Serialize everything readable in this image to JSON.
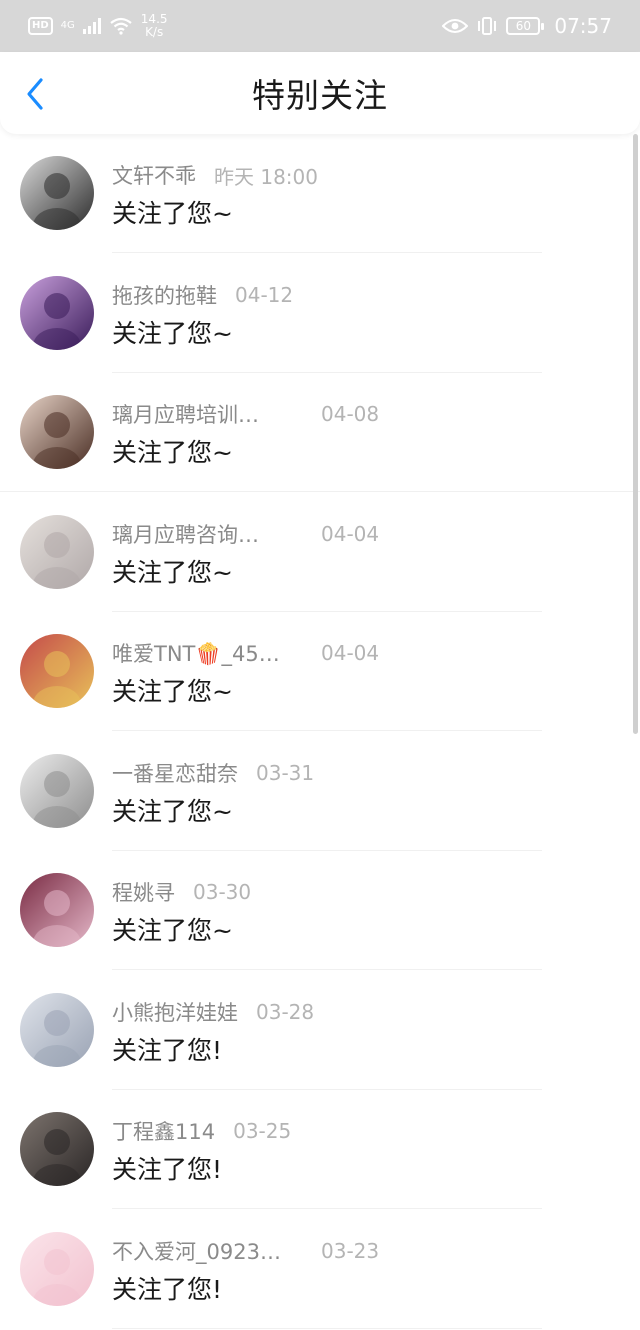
{
  "status_bar": {
    "hd": "HD",
    "network": "4G",
    "speed_value": "14.5",
    "speed_unit": "K/s",
    "battery": "60",
    "time": "07:57"
  },
  "header": {
    "title": "特别关注",
    "back_icon": "chevron-left-icon",
    "accent": "#1a8cff"
  },
  "items": [
    {
      "name": "文轩不乖",
      "time": "昨天 18:00",
      "message": "关注了您~",
      "avatar_colors": [
        "#2b2b2b",
        "#d9d9d9"
      ]
    },
    {
      "name": "拖孩的拖鞋",
      "time": "04-12",
      "message": "关注了您~",
      "avatar_colors": [
        "#3a1c5a",
        "#c9a0dc"
      ]
    },
    {
      "name": "璃月应聘培训…",
      "time": "04-08",
      "message": "关注了您~",
      "avatar_colors": [
        "#4a2e24",
        "#e7d3c7"
      ]
    },
    {
      "name": "璃月应聘咨询…",
      "time": "04-04",
      "message": "关注了您~",
      "avatar_colors": [
        "#b0a8a8",
        "#e5e0dc"
      ]
    },
    {
      "name": "唯爱TNT🍿_45…",
      "time": "04-04",
      "message": "关注了您~",
      "avatar_colors": [
        "#e8c15a",
        "#c44a4a"
      ]
    },
    {
      "name": "一番星恋甜奈",
      "time": "03-31",
      "message": "关注了您~",
      "avatar_colors": [
        "#8e8e8e",
        "#ececec"
      ]
    },
    {
      "name": "程姚寻",
      "time": "03-30",
      "message": "关注了您~",
      "avatar_colors": [
        "#e4b7c8",
        "#7a2c44"
      ]
    },
    {
      "name": "小熊抱洋娃娃",
      "time": "03-28",
      "message": "关注了您!",
      "avatar_colors": [
        "#9aa3b4",
        "#dfe3ea"
      ]
    },
    {
      "name": "丁程鑫114",
      "time": "03-25",
      "message": "关注了您!",
      "avatar_colors": [
        "#2a2626",
        "#7d746e"
      ]
    },
    {
      "name": "不入爱河_0923…",
      "time": "03-23",
      "message": "关注了您!",
      "avatar_colors": [
        "#f2c2cf",
        "#fbe4ea"
      ]
    }
  ]
}
